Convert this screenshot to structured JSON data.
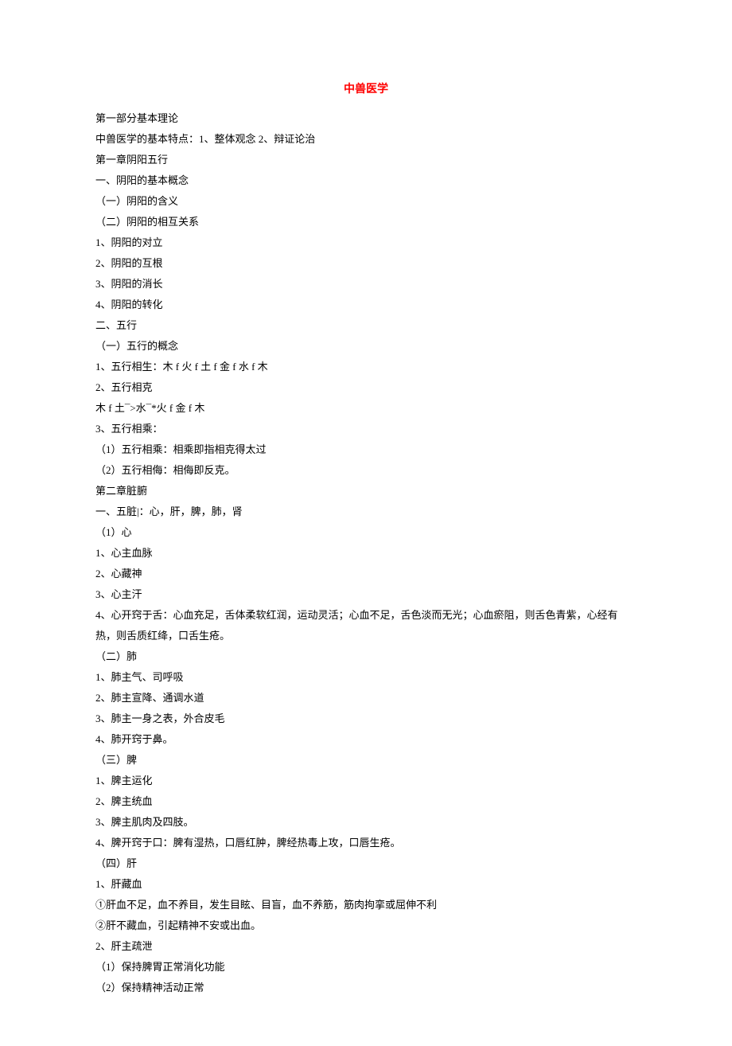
{
  "title": "中兽医学",
  "lines": [
    "第一部分基本理论",
    "中兽医学的基本特点：1、整体观念 2、辩证论治",
    "第一章阴阳五行",
    "一、阴阳的基本概念",
    "（一）阴阳的含义",
    "（二）阴阳的相互关系",
    "1、阴阳的对立",
    "2、阴阳的互根",
    "3、阴阳的消长",
    "4、阴阳的转化",
    "二、五行",
    "（一）五行的概念",
    "1、五行相生：木 f 火 f 土 f 金 f 水 f 木",
    "2、五行相克",
    "木 f 土¯>水¯*火 f 金 f 木",
    "3、五行相乘：",
    "（1）五行相乘：相乘即指相克得太过",
    "（2）五行相侮：相侮即反克。",
    "第二章脏腑",
    "一、五脏|：心，肝，脾，肺，肾",
    "（1）心",
    "1、心主血脉",
    "2、心藏神",
    "3、心主汗",
    "4、心开窍于舌：心血充足，舌体柔软红润，运动灵活；心血不足，舌色淡而无光；心血瘀阻，则舌色青紫，心经有热，则舌质红绛，口舌生疮。",
    "（二）肺",
    "1、肺主气、司呼吸",
    "2、肺主宣降、通调水道",
    "3、肺主一身之表，外合皮毛",
    "4、肺开窍于鼻。",
    "（三）脾",
    "1、脾主运化",
    "2、脾主统血",
    "3、脾主肌肉及四肢。",
    "4、脾开窍于口：脾有湿热，口唇红肿，脾经热毒上攻，口唇生疮。",
    "（四）肝",
    "1、肝藏血",
    "①肝血不足，血不养目，发生目眩、目盲，血不养筋，筋肉拘挛或屈伸不利",
    "②肝不藏血，引起精神不安或出血。",
    "2、肝主疏泄",
    "（1）保持脾胃正常消化功能",
    "（2）保持精神活动正常"
  ]
}
